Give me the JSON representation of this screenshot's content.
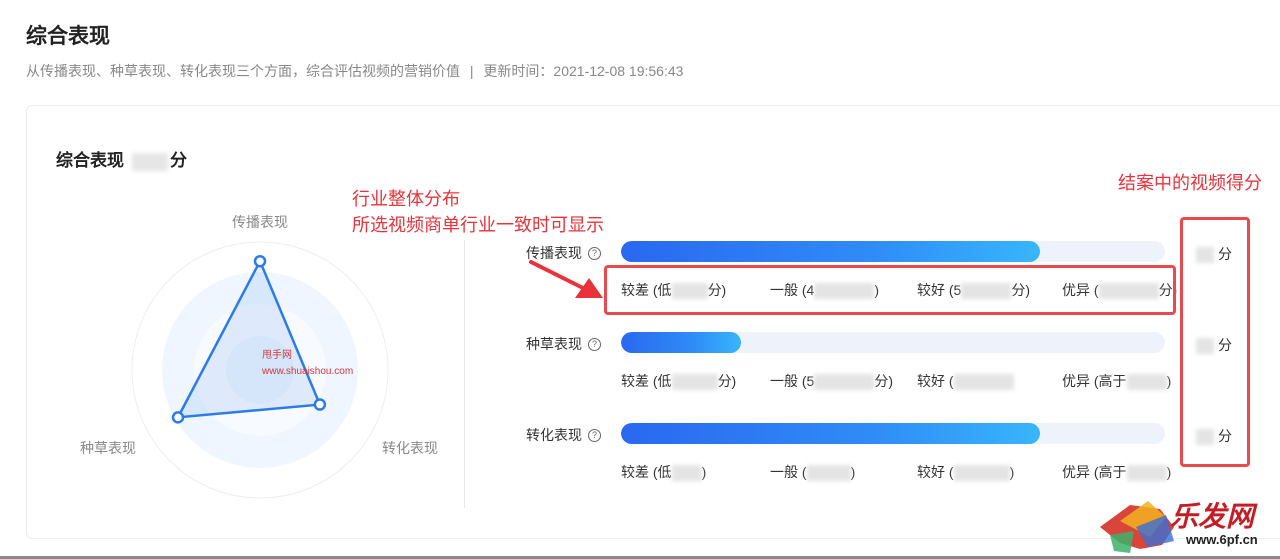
{
  "header": {
    "title": "综合表现",
    "subtitle": "从传播表现、种草表现、转化表现三个方面，综合评估视频的营销价值",
    "separator": "|",
    "update_prefix": "更新时间：",
    "update_time": "2021-12-08 19:56:43"
  },
  "card": {
    "title": "综合表现",
    "score_unit": "分"
  },
  "radar": {
    "axes": [
      "传播表现",
      "种草表现",
      "转化表现"
    ],
    "values": [
      0.85,
      0.74,
      0.54
    ],
    "color": "#2b7be9"
  },
  "metrics": [
    {
      "name": "传播表现",
      "fill": 0.77,
      "score_unit": "分",
      "levels": [
        {
          "prefix": "较差 (低",
          "suffix": "分)"
        },
        {
          "prefix": "一般 (4",
          "suffix": ")"
        },
        {
          "prefix": "较好 (5",
          "suffix": "分)"
        },
        {
          "prefix": "优异 (",
          "suffix": "分)"
        }
      ]
    },
    {
      "name": "种草表现",
      "fill": 0.22,
      "score_unit": "分",
      "levels": [
        {
          "prefix": "较差 (低",
          "suffix": "分)"
        },
        {
          "prefix": "一般 (5",
          "suffix": "分)"
        },
        {
          "prefix": "较好 (",
          "suffix": ""
        },
        {
          "prefix": "优异 (高于",
          "suffix": ")"
        }
      ]
    },
    {
      "name": "转化表现",
      "fill": 0.77,
      "score_unit": "分",
      "levels": [
        {
          "prefix": "较差 (低",
          "suffix": ")"
        },
        {
          "prefix": "一般 (",
          "suffix": ")"
        },
        {
          "prefix": "较好 (",
          "suffix": ")"
        },
        {
          "prefix": "优异 (高于",
          "suffix": ")"
        }
      ]
    }
  ],
  "annotations": {
    "industry_line1": "行业整体分布",
    "industry_line2": "所选视频商单行业一致时可显示",
    "score_note": "结案中的视频得分",
    "color": "#e8333a"
  },
  "watermark": {
    "center_line1": "甩手网",
    "center_line2": "www.shuaishou.com",
    "logo_text": "乐发网",
    "logo_url": "www.6pf.cn"
  }
}
